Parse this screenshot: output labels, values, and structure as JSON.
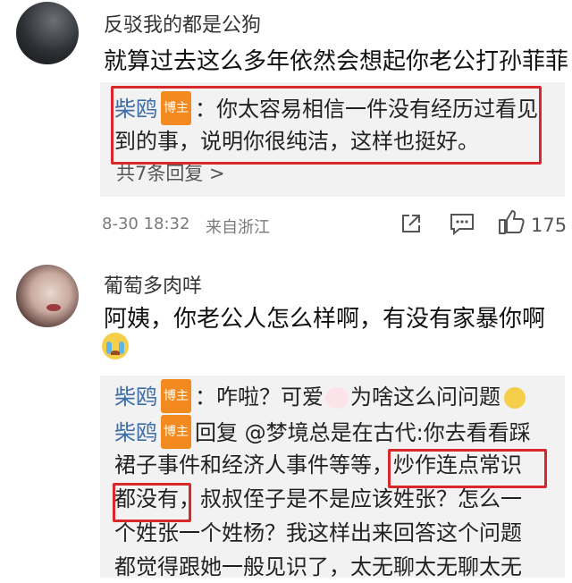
{
  "comment1": {
    "username": "反驳我的都是公狗",
    "text": "就算过去这么多年依然会想起你老公打孙菲菲",
    "reply": {
      "author": "柴鸥",
      "badge": "博主",
      "line1": "：你太容易相信一件没有经历过看见",
      "line2": "到的事，说明你很纯洁，这样也挺好。"
    },
    "more_replies": "共7条回复 >",
    "timestamp": "8-30 18:32",
    "location": "来自浙江",
    "like_count": "175"
  },
  "comment2": {
    "username": "葡萄多肉咩",
    "text": "阿姨，你老公人怎么样啊，有没有家暴你啊",
    "replies": [
      {
        "author": "柴鸥",
        "badge": "博主",
        "text_a": "：咋啦？可爱",
        "text_b": "为啥这么问问题"
      },
      {
        "author": "柴鸥",
        "badge": "博主",
        "line1": "回复 @梦境总是在古代:你去看看踩",
        "line2_a": "裙子事件和经济人事件等等，",
        "line2_b": "炒作连点常识",
        "line3_a": "都没有",
        "line3_b": "，叔叔侄子是不是应该姓张？怎么一",
        "line4": "个姓张一个姓杨？我这样出来回答这个问题",
        "line5": "都觉得跟她一般见识了，太无聊太无聊太无"
      }
    ]
  },
  "colors": {
    "highlight_border": "#d8282a",
    "badge_bg": "#f28a1f",
    "reply_bg": "#f2f2f2",
    "username_link": "#3d6ea8"
  }
}
